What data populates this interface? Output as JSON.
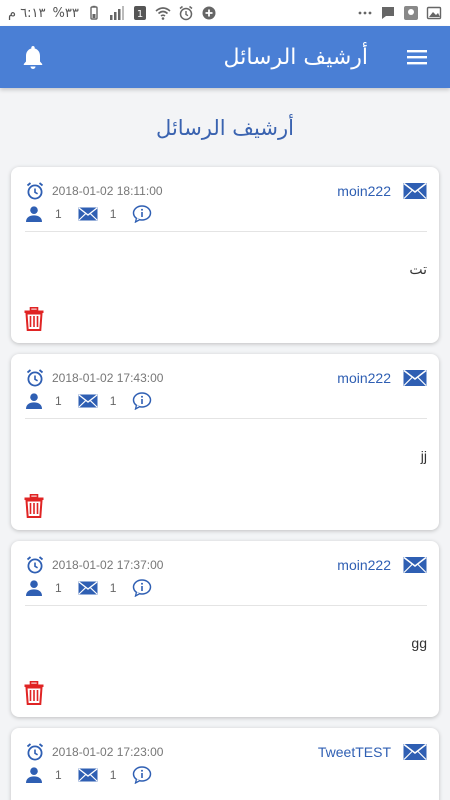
{
  "status_bar": {
    "time": "٦:١٣ م",
    "battery": "%٣٣"
  },
  "app_bar": {
    "title": "أرشيف الرسائل"
  },
  "page": {
    "heading": "أرشيف الرسائل"
  },
  "messages": [
    {
      "datetime": "2018-01-02 18:11:00",
      "sender": "moin222",
      "recipients_count": "1",
      "messages_count": "1",
      "body": "تت"
    },
    {
      "datetime": "2018-01-02 17:43:00",
      "sender": "moin222",
      "recipients_count": "1",
      "messages_count": "1",
      "body": "jj"
    },
    {
      "datetime": "2018-01-02 17:37:00",
      "sender": "moin222",
      "recipients_count": "1",
      "messages_count": "1",
      "body": "gg"
    },
    {
      "datetime": "2018-01-02 17:23:00",
      "sender": "TweetTEST",
      "recipients_count": "1",
      "messages_count": "1",
      "body": ""
    }
  ],
  "colors": {
    "primary": "#4a7fd5",
    "accent_text": "#2f5fb3",
    "delete": "#e02424"
  }
}
